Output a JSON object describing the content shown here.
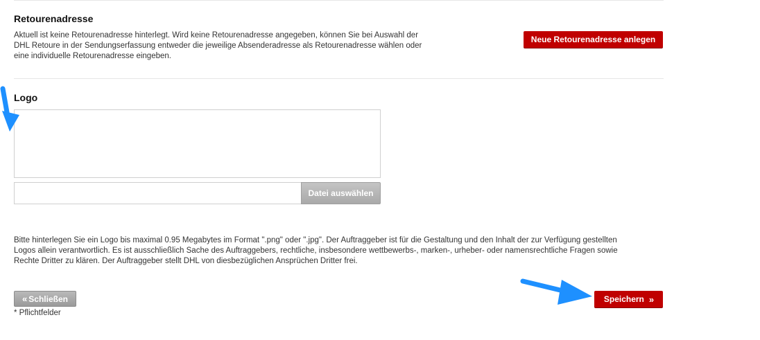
{
  "retoure": {
    "heading": "Retourenadresse",
    "description_line1": "Aktuell ist keine Retourenadresse hinterlegt. Wird keine Retourenadresse angegeben, können Sie bei Auswahl der",
    "description_line2": "DHL Retoure in der Sendungserfassung entweder die jeweilige Absenderadresse als Retourenadresse wählen oder",
    "description_line3": "eine individuelle Retourenadresse eingeben.",
    "new_button": "Neue Retourenadresse anlegen"
  },
  "logo": {
    "heading": "Logo",
    "file_button": "Datei auswählen",
    "info_line1": "Bitte hinterlegen Sie ein Logo bis maximal 0.95 Megabytes im Format \".png\" oder \".jpg\". Der Auftraggeber ist für die Gestaltung und den Inhalt der zur Verfügung gestellten",
    "info_line2": "Logos allein verantwortlich. Es ist ausschließlich Sache des Auftraggebers, rechtliche, insbesondere wettbewerbs-, marken-, urheber- oder namensrechtliche Fragen sowie",
    "info_line3": "Rechte Dritter zu klären. Der Auftraggeber stellt DHL von diesbezüglichen Ansprüchen Dritter frei."
  },
  "footer": {
    "close_label": "Schließen",
    "save_label": "Speichern",
    "required_note": "* Pflichtfelder",
    "chev_left": "«",
    "chev_right": "»"
  },
  "colors": {
    "accent": "#c00000",
    "annotation_arrow": "#1e90ff"
  },
  "icons": [
    "double-chevron-left-icon",
    "double-chevron-right-icon",
    "annotation-arrow"
  ]
}
